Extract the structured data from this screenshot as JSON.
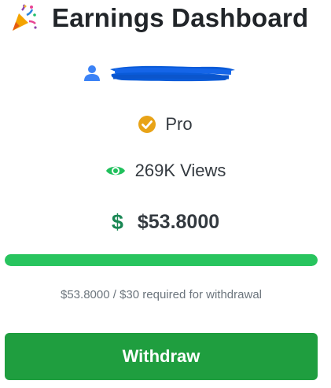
{
  "header": {
    "icon": "party-popper-icon",
    "title": "Earnings Dashboard"
  },
  "user": {
    "icon": "user-icon",
    "name_redacted": true
  },
  "plan": {
    "icon": "check-circle-icon",
    "label": "Pro",
    "icon_color": "#e8a317"
  },
  "views": {
    "icon": "eye-icon",
    "label": "269K Views",
    "icon_color": "#20c05c"
  },
  "earnings": {
    "icon": "dollar-icon",
    "amount": "$53.8000"
  },
  "progress": {
    "fraction": 1.0,
    "color": "#28c45e"
  },
  "requirement_text": "$53.8000 / $30 required for withdrawal",
  "withdraw_button": {
    "label": "Withdraw",
    "color": "#1f9e3f"
  }
}
